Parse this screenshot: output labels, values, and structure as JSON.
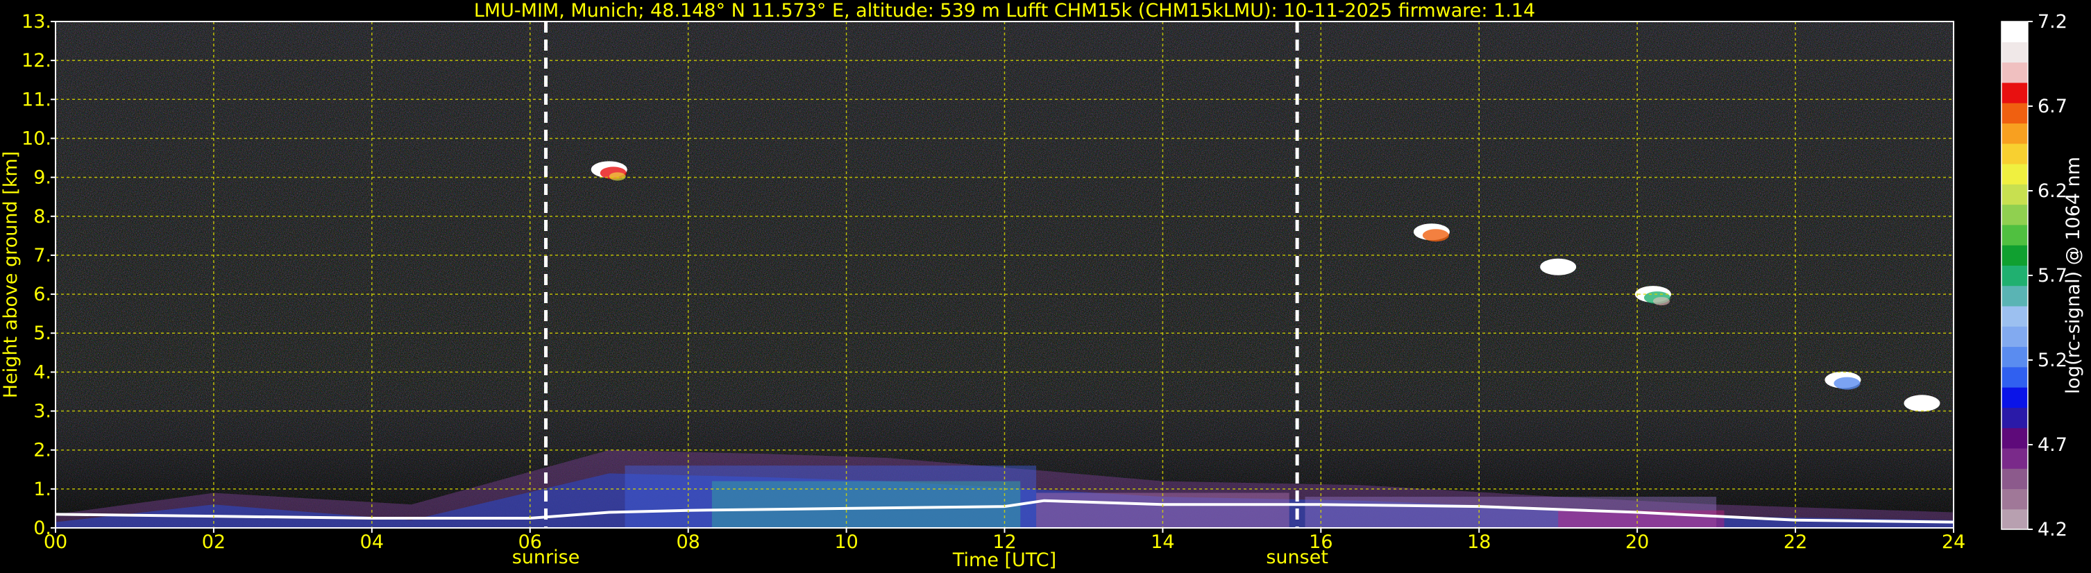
{
  "chart_data": {
    "type": "heatmap",
    "title": "LMU-MIM, Munich; 48.148° N 11.573° E, altitude: 539 m    Lufft CHM15k (CHM15kLMU): 10-11-2025    firmware: 1.14",
    "xlabel": "Time [UTC]",
    "ylabel": "Height above ground [km]",
    "xlim": [
      0,
      24
    ],
    "ylim": [
      0,
      13
    ],
    "x_ticks": [
      0,
      2,
      4,
      6,
      8,
      10,
      12,
      14,
      16,
      18,
      20,
      22,
      24
    ],
    "x_tick_labels": [
      "00",
      "02",
      "04",
      "06",
      "08",
      "10",
      "12",
      "14",
      "16",
      "18",
      "20",
      "22",
      "24"
    ],
    "y_ticks": [
      0,
      1,
      2,
      3,
      4,
      5,
      6,
      7,
      8,
      9,
      10,
      11,
      12,
      13
    ],
    "y_tick_labels": [
      "0.",
      "1.",
      "2.",
      "3.",
      "4.",
      "5.",
      "6.",
      "7.",
      "8.",
      "9.",
      "10.",
      "11.",
      "12.",
      "13."
    ],
    "grid": true,
    "grid_color": "#d6d600",
    "label_color": "#ffff00",
    "annotations": [
      {
        "text": "sunrise",
        "x": 6.2
      },
      {
        "text": "sunset",
        "x": 15.7
      }
    ],
    "colorbar": {
      "label": "log(rc-signal) @ 1064 nm",
      "min": 4.2,
      "max": 7.2,
      "ticks": [
        4.2,
        4.7,
        5.2,
        5.7,
        6.2,
        6.7,
        7.2
      ],
      "tick_labels": [
        "4.2",
        "4.7",
        "5.2",
        "5.7",
        "6.2",
        "6.7",
        "7.2"
      ],
      "colors": [
        "#b8a0b0",
        "#a07898",
        "#8c5a8c",
        "#7a2a8a",
        "#5e0a7a",
        "#2a1aa8",
        "#0a14e8",
        "#3060f0",
        "#5a8cf0",
        "#82aaf0",
        "#9cc0f0",
        "#5ab4b4",
        "#20b070",
        "#10a030",
        "#50c040",
        "#90d050",
        "#c8e050",
        "#f0f040",
        "#f8d030",
        "#f8a020",
        "#f06010",
        "#e81010",
        "#f0c0c0",
        "#f0e8e8",
        "#ffffff"
      ]
    },
    "features": [
      {
        "name": "boundary layer",
        "x_range": [
          0,
          24
        ],
        "y_range": [
          0,
          1
        ]
      },
      {
        "name": "cloud",
        "x": 7.0,
        "y": 9.2
      },
      {
        "name": "cloud",
        "x": 17.4,
        "y": 7.6
      },
      {
        "name": "cloud",
        "x": 19.0,
        "y": 6.7
      },
      {
        "name": "cloud",
        "x": 20.2,
        "y": 6.0
      },
      {
        "name": "cloud",
        "x": 22.6,
        "y": 3.8
      },
      {
        "name": "cloud",
        "x": 23.6,
        "y": 3.2
      }
    ]
  }
}
